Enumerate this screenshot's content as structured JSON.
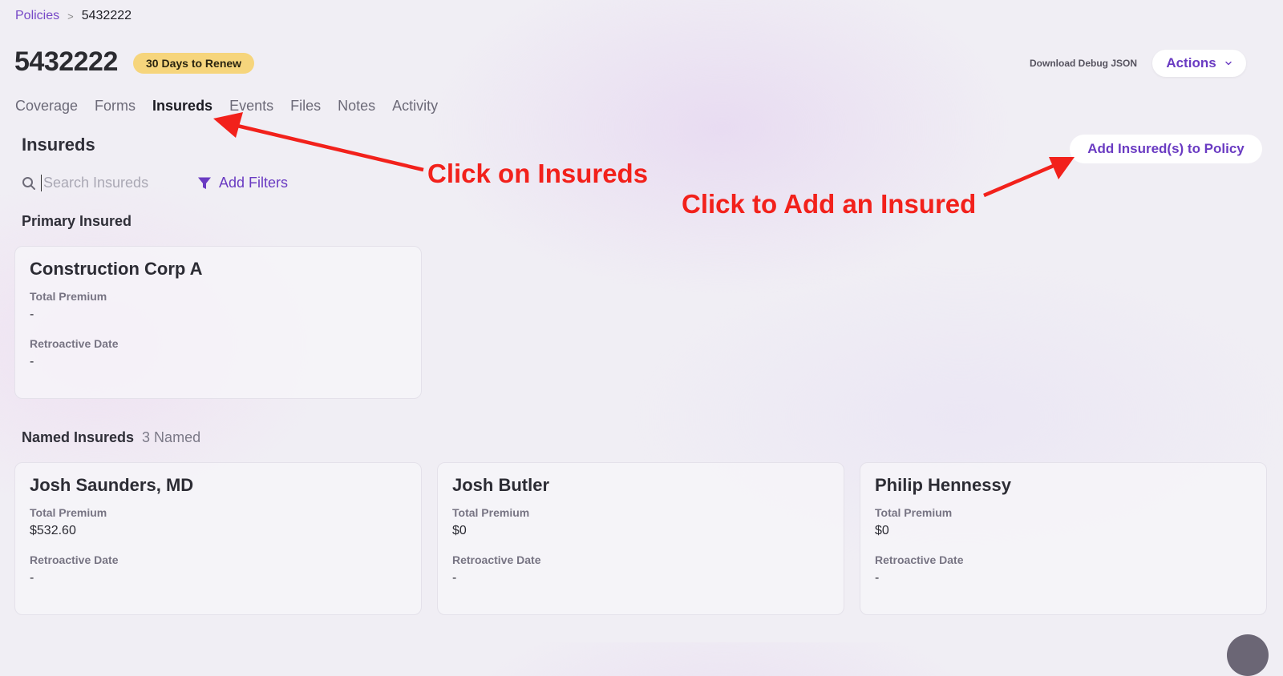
{
  "breadcrumb": {
    "root": "Policies",
    "separator": ">",
    "current": "5432222"
  },
  "header": {
    "title": "5432222",
    "badge": "30 Days to Renew",
    "debug_link": "Download Debug JSON",
    "actions_label": "Actions"
  },
  "tabs": [
    {
      "label": "Coverage",
      "active": false
    },
    {
      "label": "Forms",
      "active": false
    },
    {
      "label": "Insureds",
      "active": true
    },
    {
      "label": "Events",
      "active": false
    },
    {
      "label": "Files",
      "active": false
    },
    {
      "label": "Notes",
      "active": false
    },
    {
      "label": "Activity",
      "active": false
    }
  ],
  "insureds": {
    "title": "Insureds",
    "add_button": "Add Insured(s) to Policy",
    "search_placeholder": "Search Insureds",
    "filter_label": "Add Filters",
    "primary_heading": "Primary Insured",
    "named_heading": "Named Insureds",
    "named_count": "3 Named",
    "premium_label": "Total Premium",
    "retro_label": "Retroactive Date",
    "primary": {
      "name": "Construction Corp A",
      "premium": "-",
      "retro": "-"
    },
    "named": [
      {
        "name": "Josh Saunders, MD",
        "premium": "$532.60",
        "retro": "-"
      },
      {
        "name": "Josh Butler",
        "premium": "$0",
        "retro": "-"
      },
      {
        "name": "Philip Hennessy",
        "premium": "$0",
        "retro": "-"
      }
    ]
  },
  "annotations": {
    "tab_hint": "Click on Insureds",
    "add_hint": "Click to Add an Insured",
    "color": "#f2211b"
  },
  "colors": {
    "accent": "#6a3bc2",
    "badge": "#f6d57c"
  }
}
